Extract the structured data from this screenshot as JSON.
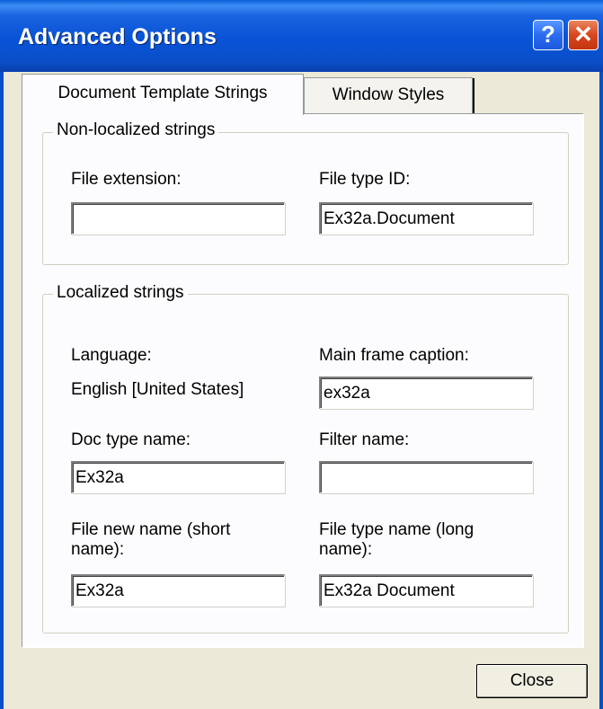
{
  "window": {
    "title": "Advanced Options",
    "help_button": "?",
    "close_button": "✕"
  },
  "tabs": [
    {
      "label": "Document Template Strings",
      "active": true
    },
    {
      "label": "Window Styles",
      "active": false
    }
  ],
  "non_localized": {
    "group_label": "Non-localized strings",
    "file_extension": {
      "label": "File extension:",
      "value": ""
    },
    "file_type_id": {
      "label": "File type ID:",
      "value": "Ex32a.Document"
    }
  },
  "localized": {
    "group_label": "Localized strings",
    "language": {
      "label": "Language:",
      "value": "English [United States]"
    },
    "main_frame_caption": {
      "label": "Main frame caption:",
      "value": "ex32a"
    },
    "doc_type_name": {
      "label": "Doc type name:",
      "value": "Ex32a"
    },
    "filter_name": {
      "label": "Filter name:",
      "value": ""
    },
    "file_new_name": {
      "label": "File new name (short name):",
      "value": "Ex32a"
    },
    "file_type_name": {
      "label": "File type name (long name):",
      "value": "Ex32a Document"
    }
  },
  "buttons": {
    "close": "Close"
  }
}
